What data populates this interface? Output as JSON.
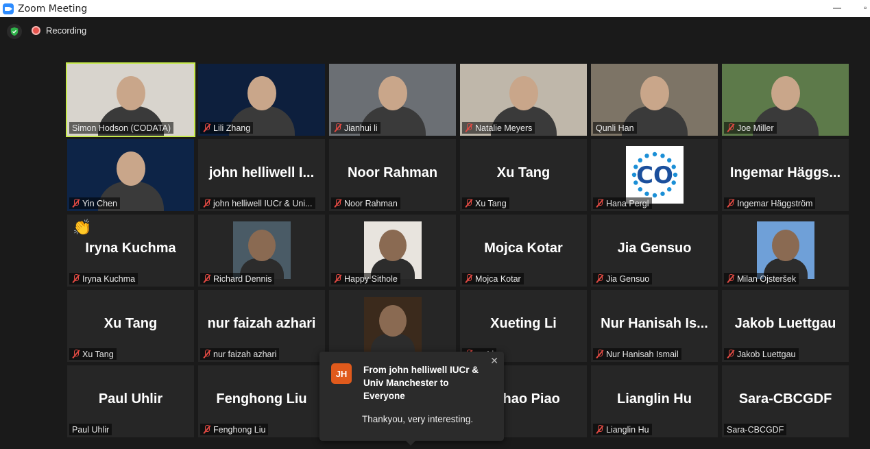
{
  "window": {
    "title": "Zoom Meeting",
    "minimize": "—",
    "restore": "▫"
  },
  "status": {
    "recording_label": "Recording"
  },
  "tiles": [
    {
      "label": "Simon Hodson (CODATA)",
      "big": "",
      "muted": false,
      "type": "video",
      "bg": "#d8d4cd"
    },
    {
      "label": "Lili Zhang",
      "big": "",
      "muted": true,
      "type": "video",
      "bg": "#0d1f3d"
    },
    {
      "label": "Jianhui li",
      "big": "",
      "muted": true,
      "type": "video",
      "bg": "#6b6f74"
    },
    {
      "label": "Natalie Meyers",
      "big": "",
      "muted": true,
      "type": "video",
      "bg": "#bfb7aa"
    },
    {
      "label": "Qunli Han",
      "big": "",
      "muted": false,
      "type": "video",
      "bg": "#7d7466"
    },
    {
      "label": "Joe Miller",
      "big": "",
      "muted": true,
      "type": "video",
      "bg": "#5d7a4a"
    },
    {
      "label": "Yin Chen",
      "big": "",
      "muted": true,
      "type": "video",
      "bg": "#0d2447"
    },
    {
      "label": "john helliwell IUCr & Uni...",
      "big": "john helliwell I...",
      "muted": true,
      "type": "name"
    },
    {
      "label": "Noor Rahman",
      "big": "Noor Rahman",
      "muted": true,
      "type": "name"
    },
    {
      "label": "Xu Tang",
      "big": "Xu Tang",
      "muted": true,
      "type": "name"
    },
    {
      "label": "Hana Pergl",
      "big": "",
      "muted": true,
      "type": "logo"
    },
    {
      "label": "Ingemar Häggström",
      "big": "Ingemar  Häggs...",
      "muted": true,
      "type": "name"
    },
    {
      "label": "Iryna Kuchma",
      "big": "Iryna Kuchma",
      "muted": true,
      "type": "name",
      "wave": "👏"
    },
    {
      "label": "Richard Dennis",
      "big": "",
      "muted": true,
      "type": "photo",
      "bg": "#4a5b66"
    },
    {
      "label": "Happy Sithole",
      "big": "",
      "muted": true,
      "type": "photo",
      "bg": "#e8e4de"
    },
    {
      "label": "Mojca Kotar",
      "big": "Mojca Kotar",
      "muted": true,
      "type": "name"
    },
    {
      "label": "Jia Gensuo",
      "big": "Jia Gensuo",
      "muted": true,
      "type": "name"
    },
    {
      "label": "Milan Ojsteršek",
      "big": "",
      "muted": true,
      "type": "photo",
      "bg": "#6fa0d8"
    },
    {
      "label": "Xu Tang",
      "big": "Xu Tang",
      "muted": true,
      "type": "name"
    },
    {
      "label": "nur faizah azhari",
      "big": "nur faizah azhari",
      "muted": true,
      "type": "name"
    },
    {
      "label": "",
      "big": "",
      "muted": false,
      "type": "photo",
      "bg": "#3b2a1c"
    },
    {
      "label": "ng Li",
      "big": "Xueting Li",
      "muted": true,
      "type": "name"
    },
    {
      "label": "Nur Hanisah Ismail",
      "big": "Nur Hanisah Is...",
      "muted": true,
      "type": "name"
    },
    {
      "label": "Jakob Luettgau",
      "big": "Jakob Luettgau",
      "muted": true,
      "type": "name"
    },
    {
      "label": "Paul Uhlir",
      "big": "Paul Uhlir",
      "muted": false,
      "type": "name"
    },
    {
      "label": "Fenghong Liu",
      "big": "Fenghong Liu",
      "muted": true,
      "type": "name"
    },
    {
      "label": "",
      "big": "",
      "muted": false,
      "type": "hidden"
    },
    {
      "label": "hao Piao",
      "big": "gchao Piao",
      "muted": false,
      "type": "name"
    },
    {
      "label": "Lianglin Hu",
      "big": "Lianglin Hu",
      "muted": true,
      "type": "name"
    },
    {
      "label": "Sara-CBCGDF",
      "big": "Sara-CBCGDF",
      "muted": false,
      "type": "name"
    }
  ],
  "chat": {
    "initials": "JH",
    "from": "From john helliwell IUCr & Univ Manchester to Everyone",
    "message": "Thankyou, very interesting.",
    "close": "✕"
  },
  "colors": {
    "active_speaker": "#c6e94c",
    "muted_icon": "#e24a43",
    "avatar_orange": "#e05a1c"
  }
}
